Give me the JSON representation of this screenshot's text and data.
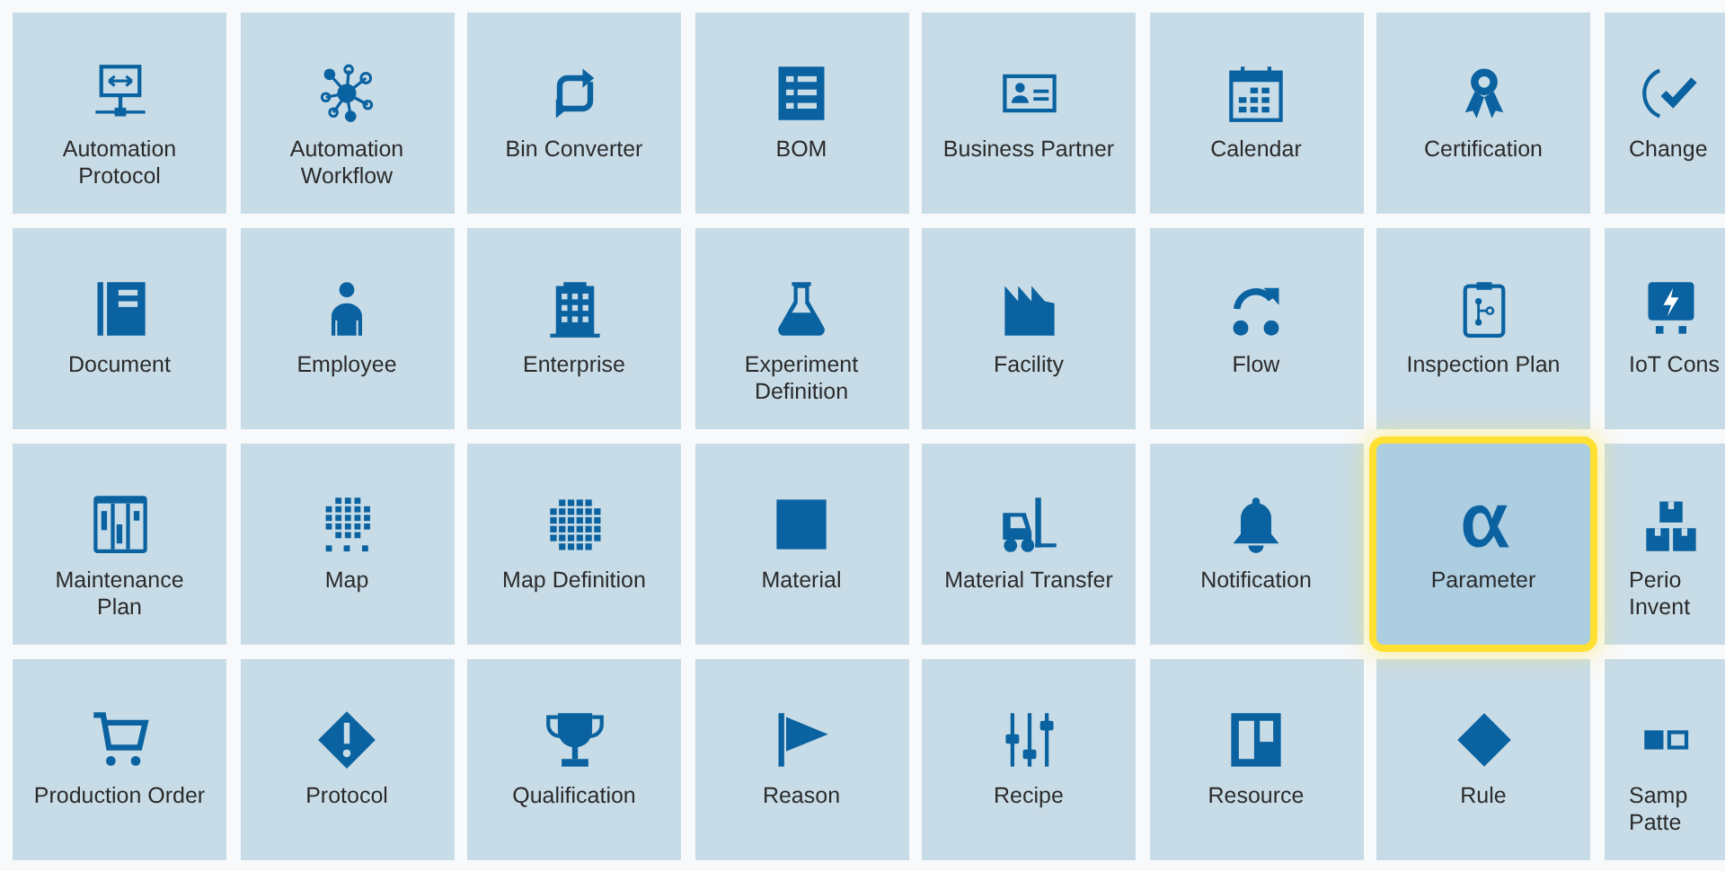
{
  "tiles": [
    {
      "label": "Automation Protocol",
      "selected": false
    },
    {
      "label": "Automation Workflow",
      "selected": false
    },
    {
      "label": "Bin Converter",
      "selected": false
    },
    {
      "label": "BOM",
      "selected": false
    },
    {
      "label": "Business Partner",
      "selected": false
    },
    {
      "label": "Calendar",
      "selected": false
    },
    {
      "label": "Certification",
      "selected": false
    },
    {
      "label": "Change",
      "selected": false
    },
    {
      "label": "Document",
      "selected": false
    },
    {
      "label": "Employee",
      "selected": false
    },
    {
      "label": "Enterprise",
      "selected": false
    },
    {
      "label": "Experiment Definition",
      "selected": false
    },
    {
      "label": "Facility",
      "selected": false
    },
    {
      "label": "Flow",
      "selected": false
    },
    {
      "label": "Inspection Plan",
      "selected": false
    },
    {
      "label": "IoT Cons",
      "selected": false
    },
    {
      "label": "Maintenance Plan",
      "selected": false
    },
    {
      "label": "Map",
      "selected": false
    },
    {
      "label": "Map Definition",
      "selected": false
    },
    {
      "label": "Material",
      "selected": false
    },
    {
      "label": "Material Transfer",
      "selected": false
    },
    {
      "label": "Notification",
      "selected": false
    },
    {
      "label": "Parameter",
      "selected": true
    },
    {
      "label": "Perio Invent",
      "selected": false
    },
    {
      "label": "Production Order",
      "selected": false
    },
    {
      "label": "Protocol",
      "selected": false
    },
    {
      "label": "Qualification",
      "selected": false
    },
    {
      "label": "Reason",
      "selected": false
    },
    {
      "label": "Recipe",
      "selected": false
    },
    {
      "label": "Resource",
      "selected": false
    },
    {
      "label": "Rule",
      "selected": false
    },
    {
      "label": "Samp Patte",
      "selected": false
    }
  ]
}
